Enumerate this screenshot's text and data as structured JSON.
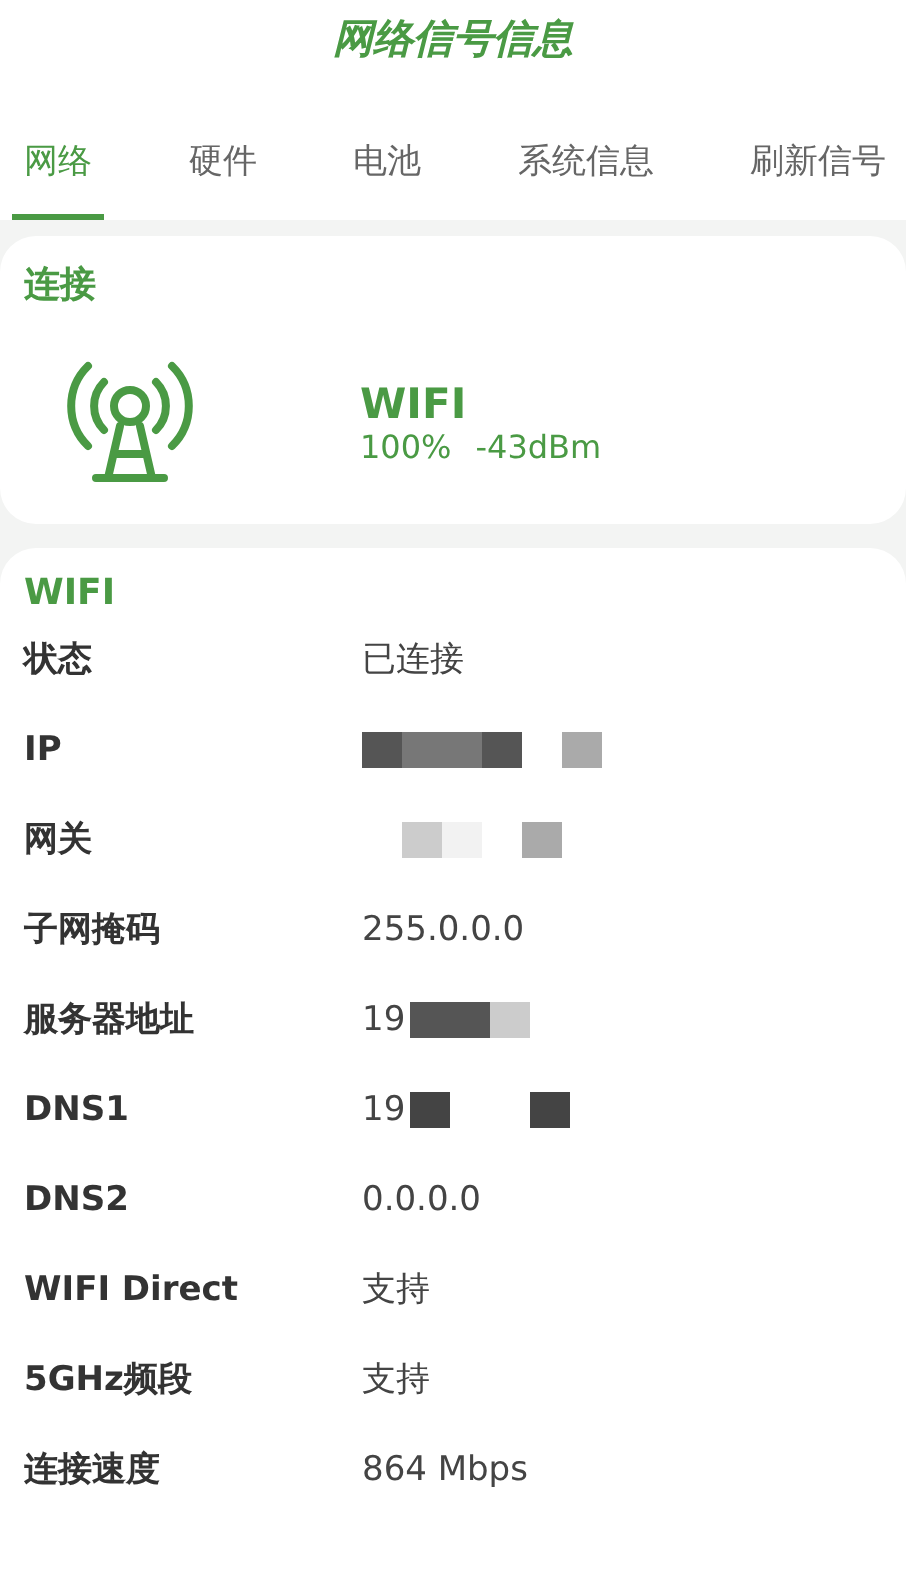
{
  "title": "网络信号信息",
  "tabs": [
    {
      "label": "网络",
      "selected": true
    },
    {
      "label": "硬件",
      "selected": false
    },
    {
      "label": "电池",
      "selected": false
    },
    {
      "label": "系统信息",
      "selected": false
    },
    {
      "label": "刷新信号",
      "selected": false
    }
  ],
  "connection": {
    "heading": "连接",
    "type": "WIFI",
    "strength": "100%",
    "signal": "-43dBm"
  },
  "wifi": {
    "heading": "WIFI",
    "rows": [
      {
        "label": "状态",
        "kind": "text",
        "value": "已连接"
      },
      {
        "label": "IP",
        "kind": "masked"
      },
      {
        "label": "网关",
        "kind": "masked"
      },
      {
        "label": "子网掩码",
        "kind": "text",
        "value": "255.0.0.0"
      },
      {
        "label": "服务器地址",
        "kind": "masked",
        "value": "19"
      },
      {
        "label": "DNS1",
        "kind": "masked",
        "value": "19"
      },
      {
        "label": "DNS2",
        "kind": "text",
        "value": "0.0.0.0"
      },
      {
        "label": "WIFI Direct",
        "kind": "text",
        "value": "支持"
      },
      {
        "label": "5GHz频段",
        "kind": "text",
        "value": "支持"
      },
      {
        "label": "连接速度",
        "kind": "text",
        "value": "864 Mbps"
      }
    ]
  }
}
